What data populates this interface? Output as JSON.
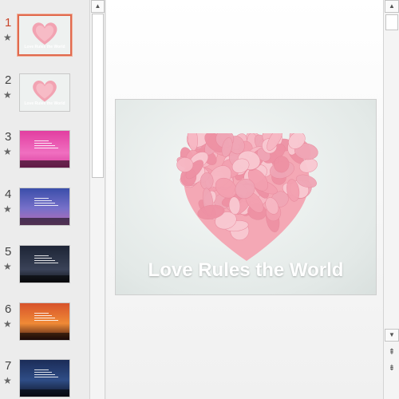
{
  "thumbnails": [
    {
      "number": "1",
      "caption": "Love Rules the World",
      "style": "heart",
      "active": true
    },
    {
      "number": "2",
      "caption": "Love Rules the World",
      "style": "heart",
      "active": false
    },
    {
      "number": "3",
      "caption": "",
      "style": "pink",
      "active": false
    },
    {
      "number": "4",
      "caption": "",
      "style": "dusk",
      "active": false
    },
    {
      "number": "5",
      "caption": "",
      "style": "night",
      "active": false
    },
    {
      "number": "6",
      "caption": "",
      "style": "sunset",
      "active": false
    },
    {
      "number": "7",
      "caption": "",
      "style": "blue",
      "active": false
    }
  ],
  "icons": {
    "transition": "star-icon",
    "scroll_up": "triangle-up-icon",
    "scroll_down": "triangle-down-icon",
    "prev_slide": "double-chevron-up-icon",
    "next_slide": "double-chevron-down-icon"
  },
  "glyphs": {
    "star": "★",
    "up": "▲",
    "down": "▼",
    "prev": "⇞",
    "next": "⇟"
  },
  "slide": {
    "title": "Love Rules the World"
  },
  "colors": {
    "active_number": "#c8452a",
    "active_border": "#e16a4e",
    "petal": "#f4a8b5"
  }
}
